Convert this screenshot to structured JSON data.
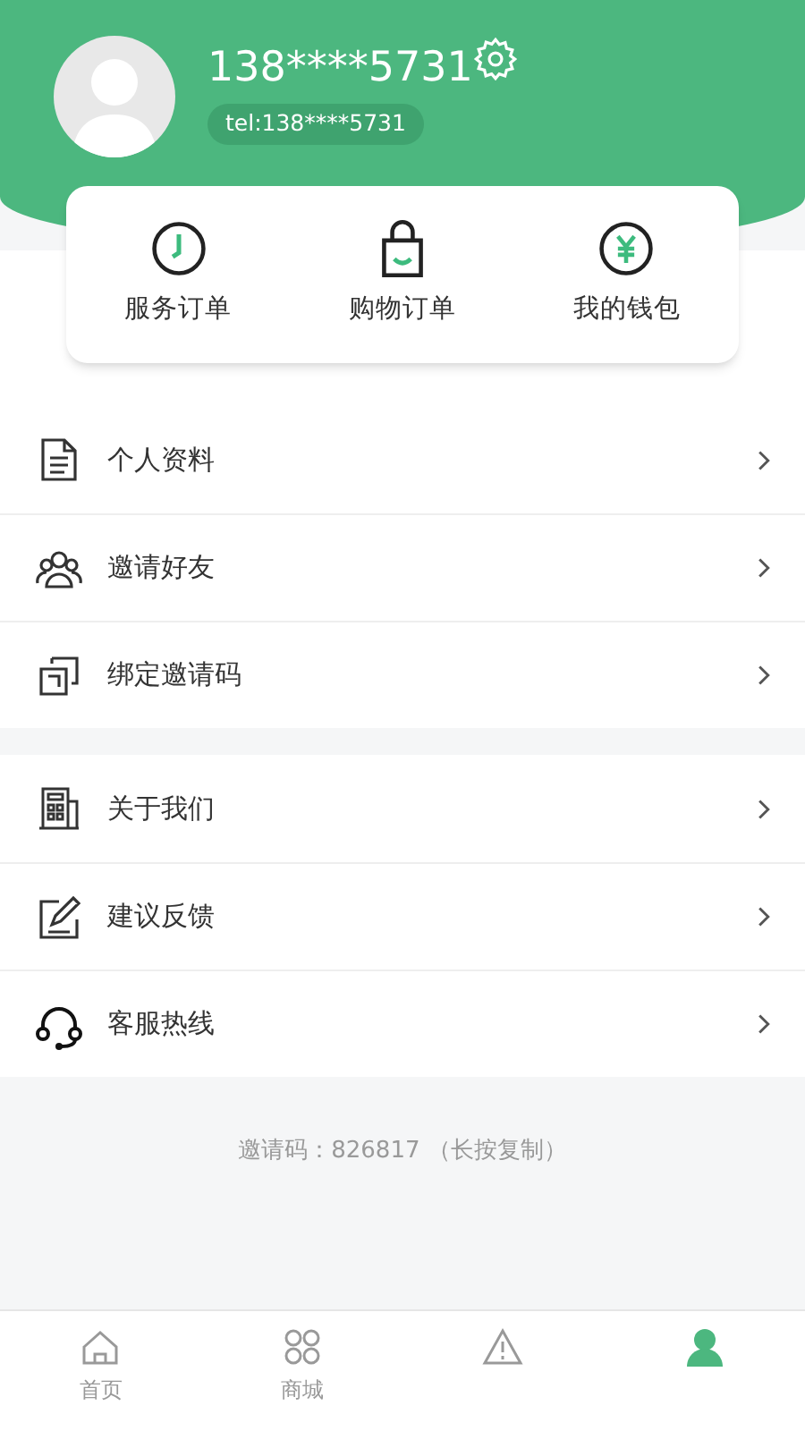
{
  "profile": {
    "name": "138****5731",
    "tel": "tel:138****5731"
  },
  "shortcuts": [
    {
      "kind": "clock",
      "label": "服务订单"
    },
    {
      "kind": "bag",
      "label": "购物订单"
    },
    {
      "kind": "yen",
      "label": "我的钱包"
    }
  ],
  "menu_groups": [
    [
      {
        "kind": "doc",
        "label": "个人资料"
      },
      {
        "kind": "people",
        "label": "邀请好友"
      },
      {
        "kind": "link",
        "label": "绑定邀请码"
      }
    ],
    [
      {
        "kind": "building",
        "label": "关于我们"
      },
      {
        "kind": "edit",
        "label": "建议反馈"
      },
      {
        "kind": "headset",
        "label": "客服热线"
      }
    ]
  ],
  "invite_note": "邀请码：826817 （长按复制）",
  "tab_bar": [
    {
      "kind": "home",
      "label": "首页",
      "selected": false
    },
    {
      "kind": "grid",
      "label": "商城",
      "selected": false
    },
    {
      "kind": "alert",
      "selected": false
    },
    {
      "kind": "person",
      "selected": true
    }
  ]
}
